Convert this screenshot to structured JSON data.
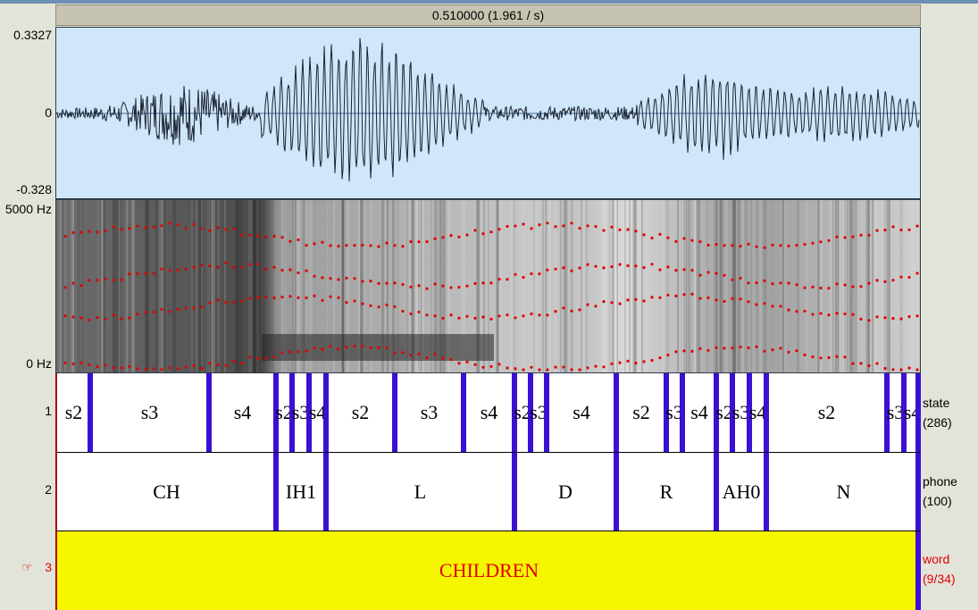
{
  "selection": {
    "duration_label": "0.510000 (1.961 / s)"
  },
  "waveform": {
    "max_label": "0.3327",
    "zero_label": "0",
    "min_label": "-0.328"
  },
  "spectrogram": {
    "top_label": "5000 Hz",
    "bottom_label": "0 Hz"
  },
  "tiers": [
    {
      "number": "1",
      "name": "state",
      "count": "(286)",
      "intervals": [
        {
          "label": "s2",
          "start": 0,
          "end": 37
        },
        {
          "label": "s3",
          "start": 37,
          "end": 170
        },
        {
          "label": "s4",
          "start": 170,
          "end": 245
        },
        {
          "label": "s|2",
          "start": 245,
          "end": 263
        },
        {
          "label": "s|3",
          "start": 263,
          "end": 282
        },
        {
          "label": "s|4",
          "start": 282,
          "end": 301
        },
        {
          "label": "s2",
          "start": 301,
          "end": 378
        },
        {
          "label": "s3",
          "start": 378,
          "end": 455
        },
        {
          "label": "s4",
          "start": 455,
          "end": 512
        },
        {
          "label": "s|2",
          "start": 512,
          "end": 530
        },
        {
          "label": "s|3",
          "start": 530,
          "end": 548
        },
        {
          "label": "s4",
          "start": 548,
          "end": 626
        },
        {
          "label": "s2",
          "start": 626,
          "end": 682
        },
        {
          "label": "s|3",
          "start": 682,
          "end": 700
        },
        {
          "label": "s4",
          "start": 700,
          "end": 738
        },
        {
          "label": "s|2",
          "start": 738,
          "end": 756
        },
        {
          "label": "s|3",
          "start": 756,
          "end": 775
        },
        {
          "label": "s|4",
          "start": 775,
          "end": 794
        },
        {
          "label": "s2",
          "start": 794,
          "end": 929
        },
        {
          "label": "s|3",
          "start": 929,
          "end": 948
        },
        {
          "label": "s|4",
          "start": 948,
          "end": 967
        }
      ]
    },
    {
      "number": "2",
      "name": "phone",
      "count": "(100)",
      "intervals": [
        {
          "label": "CH",
          "start": 0,
          "end": 245
        },
        {
          "label": "IH1",
          "start": 245,
          "end": 301
        },
        {
          "label": "L",
          "start": 301,
          "end": 512
        },
        {
          "label": "D",
          "start": 512,
          "end": 626
        },
        {
          "label": "R",
          "start": 626,
          "end": 738
        },
        {
          "label": "AH0",
          "start": 738,
          "end": 794
        },
        {
          "label": "N",
          "start": 794,
          "end": 967
        }
      ]
    },
    {
      "number": "3",
      "name": "word",
      "count": "(9/34)",
      "pointer": "☞",
      "intervals": [
        {
          "label": "CHILDREN",
          "start": 0,
          "end": 967
        }
      ]
    }
  ],
  "colors": {
    "boundary": "#3b10d4",
    "selected_tier": "#f6f600",
    "active_text": "#e00000",
    "wave_bg": "#cfe6fb",
    "formant_dots": "#e00000"
  }
}
